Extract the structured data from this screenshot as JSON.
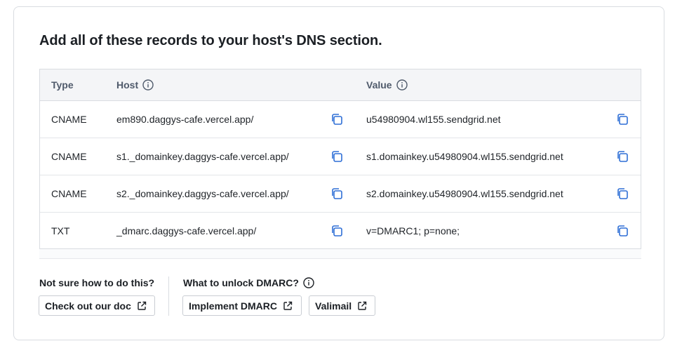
{
  "heading": "Add all of these records to your host's DNS section.",
  "table": {
    "columns": {
      "type": "Type",
      "host": "Host",
      "value": "Value"
    },
    "rows": [
      {
        "type": "CNAME",
        "host": "em890.daggys-cafe.vercel.app/",
        "value": "u54980904.wl155.sendgrid.net"
      },
      {
        "type": "CNAME",
        "host": "s1._domainkey.daggys-cafe.vercel.app/",
        "value": "s1.domainkey.u54980904.wl155.sendgrid.net"
      },
      {
        "type": "CNAME",
        "host": "s2._domainkey.daggys-cafe.vercel.app/",
        "value": "s2.domainkey.u54980904.wl155.sendgrid.net"
      },
      {
        "type": "TXT",
        "host": "_dmarc.daggys-cafe.vercel.app/",
        "value": "v=DMARC1; p=none;"
      }
    ]
  },
  "help": {
    "label": "Not sure how to do this?",
    "doc_button": "Check out our doc"
  },
  "dmarc": {
    "label": "What to unlock DMARC?",
    "implement_button": "Implement DMARC",
    "valimail_button": "Valimail"
  },
  "colors": {
    "copy_icon": "#2f6fd6",
    "border": "#d9dce1",
    "header_bg": "#f4f5f7"
  },
  "icons": {
    "info": "info-circle-icon",
    "copy": "copy-icon",
    "external": "external-link-icon"
  }
}
